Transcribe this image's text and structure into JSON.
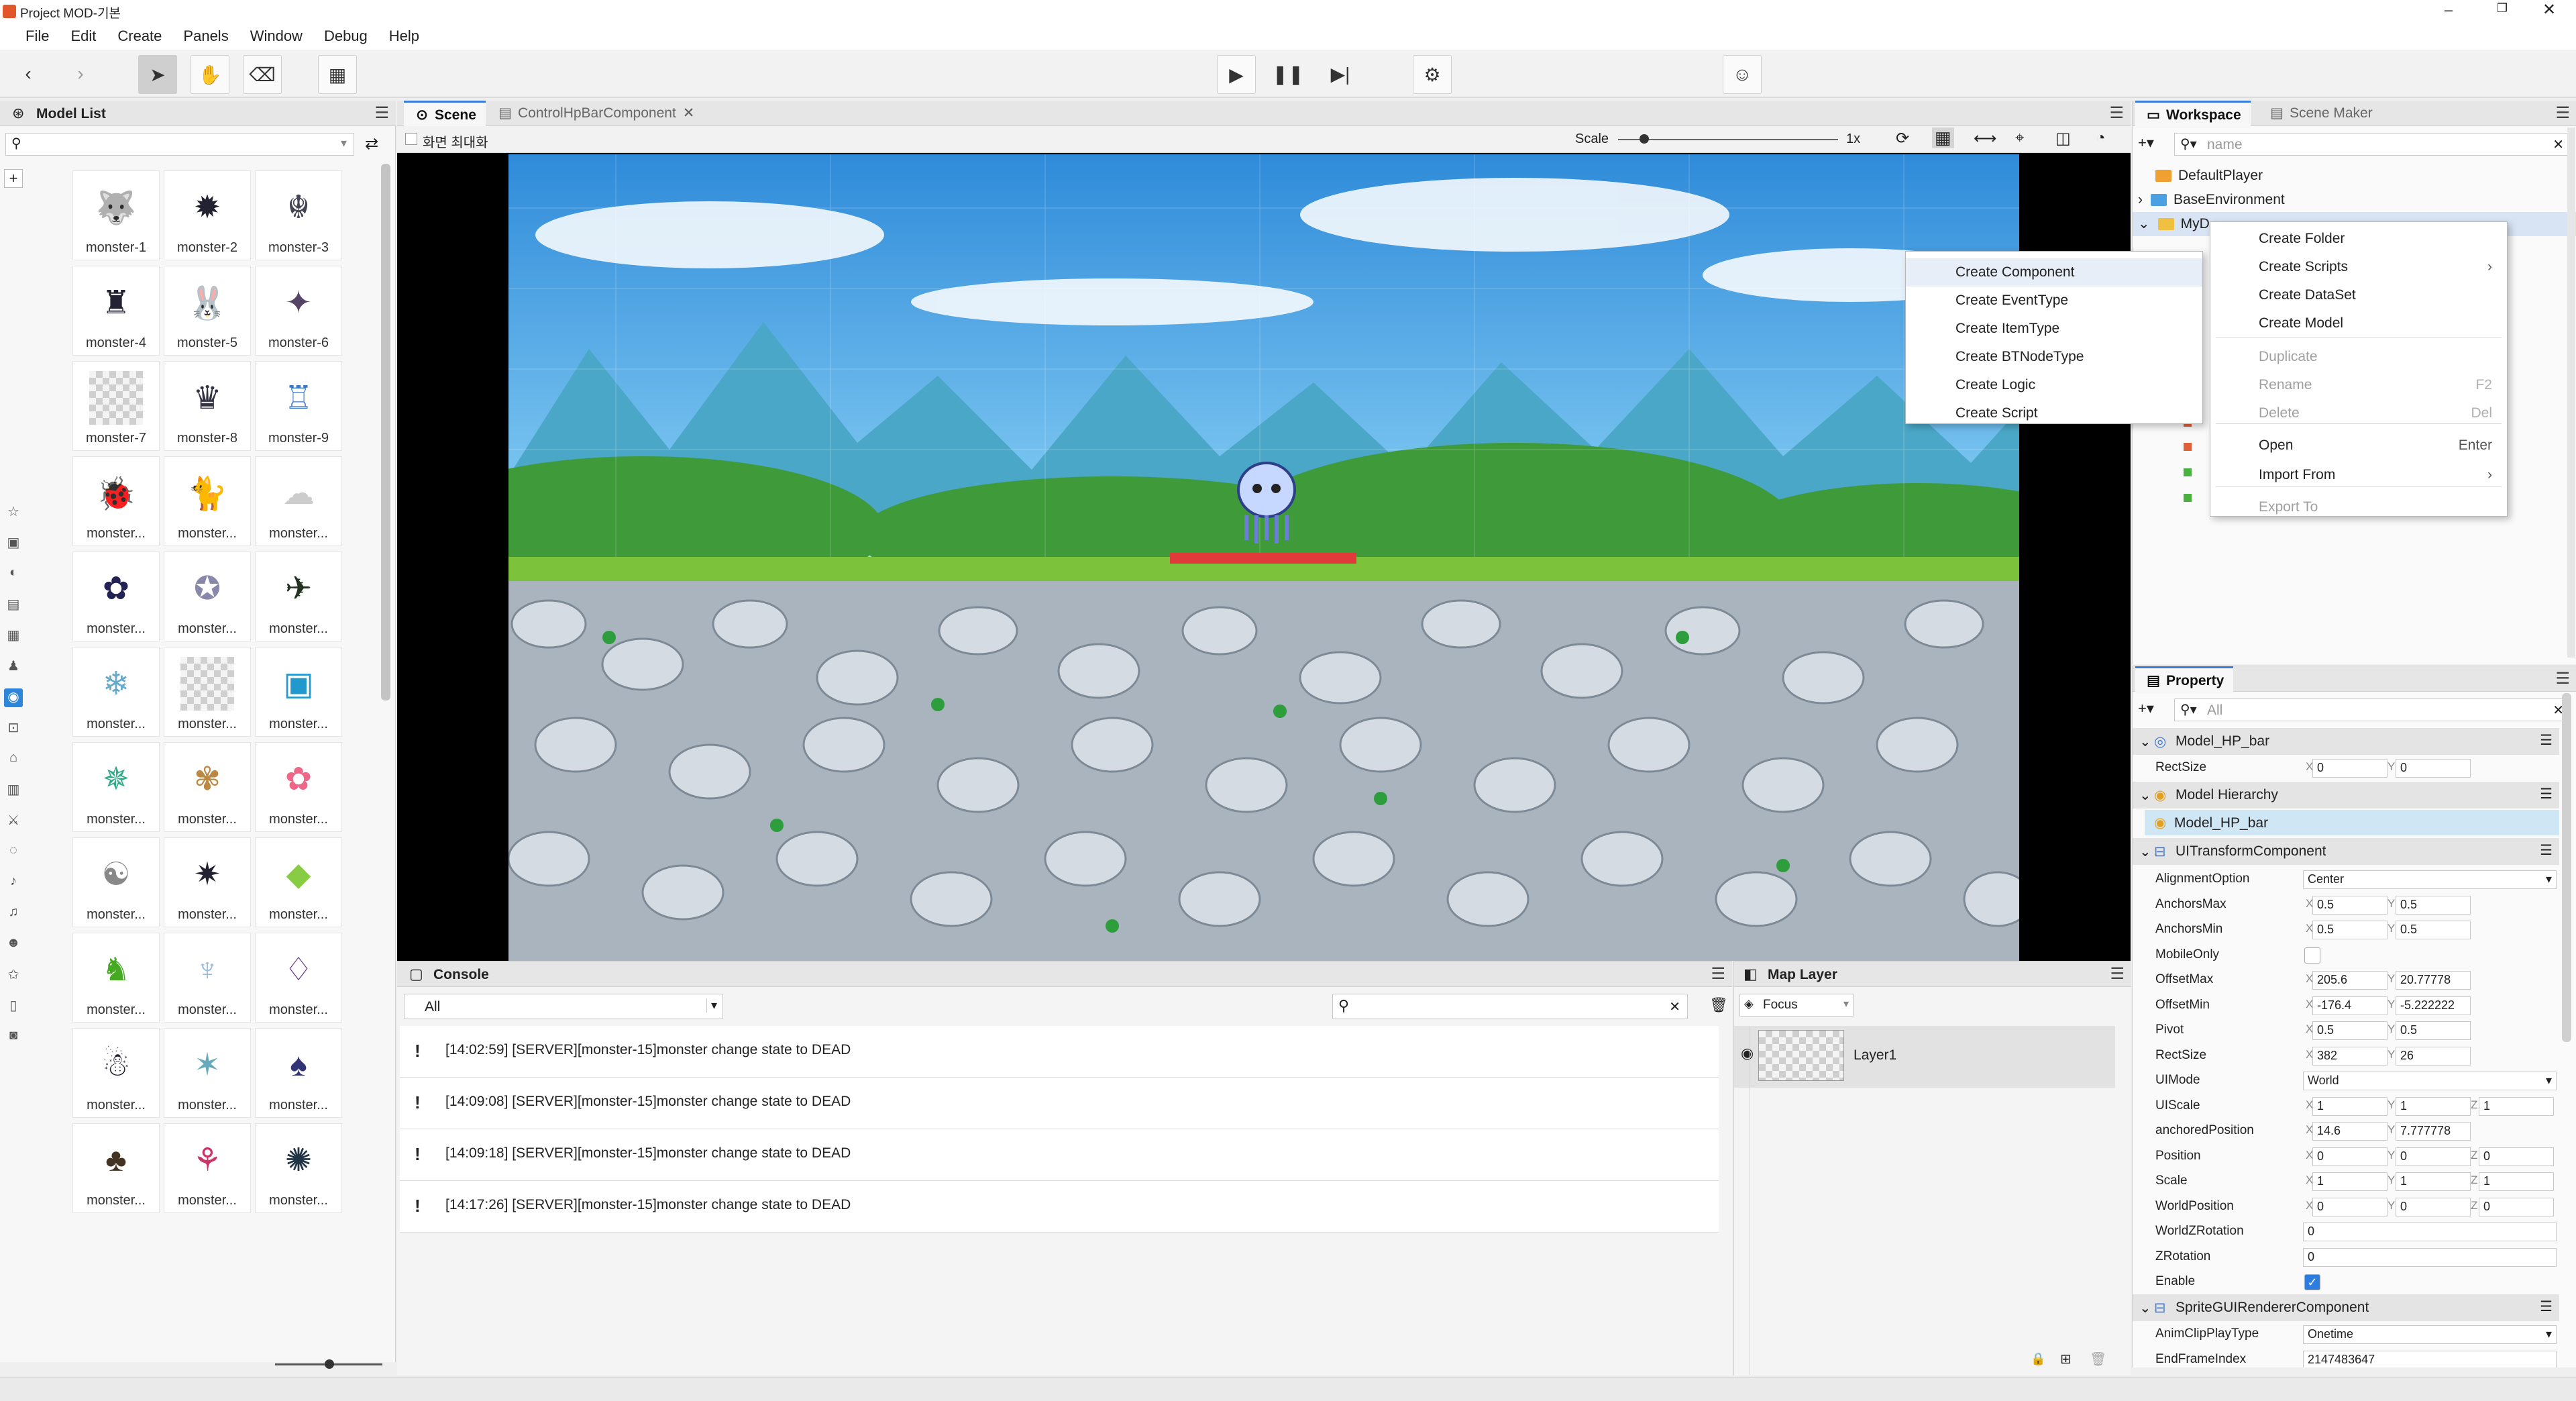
{
  "window": {
    "title": "Project MOD-기본"
  },
  "menu": [
    "File",
    "Edit",
    "Create",
    "Panels",
    "Window",
    "Debug",
    "Help"
  ],
  "model_list": {
    "title": "Model List",
    "search_placeholder": "",
    "items": [
      "monster-1",
      "monster-2",
      "monster-3",
      "monster-4",
      "monster-5",
      "monster-6",
      "monster-7",
      "monster-8",
      "monster-9",
      "monster...",
      "monster...",
      "monster...",
      "monster...",
      "monster...",
      "monster...",
      "monster...",
      "monster...",
      "monster...",
      "monster...",
      "monster...",
      "monster...",
      "monster...",
      "monster...",
      "monster...",
      "monster...",
      "monster...",
      "monster...",
      "monster...",
      "monster...",
      "monster...",
      "monster...",
      "monster...",
      "monster..."
    ]
  },
  "scene": {
    "tabs": [
      "Scene",
      "ControlHpBarComponent"
    ],
    "maximize_label": "화면 최대화",
    "scale_label": "Scale",
    "scale_value": "1x",
    "scale_slider_value": 0.12
  },
  "console": {
    "title": "Console",
    "filter": "All",
    "logs": [
      "[14:02:59] [SERVER][monster-15]monster change state to DEAD",
      "[14:09:08] [SERVER][monster-15]monster change state to DEAD",
      "[14:09:18] [SERVER][monster-15]monster change state to DEAD",
      "[14:17:26] [SERVER][monster-15]monster change state to DEAD"
    ]
  },
  "map_layer": {
    "title": "Map Layer",
    "focus_label": "Focus",
    "layers": [
      "Layer1"
    ]
  },
  "workspace": {
    "tabs": [
      "Workspace",
      "Scene Maker"
    ],
    "search_placeholder": "name",
    "tree": [
      "DefaultPlayer",
      "BaseEnvironment",
      "MyD"
    ]
  },
  "context_menu_main": [
    {
      "label": "Create Folder",
      "shortcut": "",
      "disabled": false
    },
    {
      "label": "Create Scripts",
      "shortcut": "›",
      "disabled": false
    },
    {
      "label": "Create DataSet",
      "shortcut": "",
      "disabled": false
    },
    {
      "label": "Create Model",
      "shortcut": "",
      "disabled": false
    },
    {
      "label": "Duplicate",
      "shortcut": "",
      "disabled": true
    },
    {
      "label": "Rename",
      "shortcut": "F2",
      "disabled": true
    },
    {
      "label": "Delete",
      "shortcut": "Del",
      "disabled": true
    },
    {
      "label": "Open",
      "shortcut": "Enter",
      "disabled": false
    },
    {
      "label": "Import From",
      "shortcut": "›",
      "disabled": false
    },
    {
      "label": "Export To",
      "shortcut": "",
      "disabled": true
    }
  ],
  "context_menu_sub": [
    "Create Component",
    "Create EventType",
    "Create ItemType",
    "Create BTNodeType",
    "Create Logic",
    "Create Script"
  ],
  "property": {
    "title": "Property",
    "search_placeholder": "All",
    "model_name": "Model_HP_bar",
    "rectsize_top": {
      "label": "RectSize",
      "x": "0",
      "y": "0"
    },
    "hierarchy_title": "Model Hierarchy",
    "hierarchy_item": "Model_HP_bar",
    "ui_transform_title": "UITransformComponent",
    "rows": [
      {
        "label": "AlignmentOption",
        "value": "Center"
      },
      {
        "label": "AnchorsMax",
        "x": "0.5",
        "y": "0.5"
      },
      {
        "label": "AnchorsMin",
        "x": "0.5",
        "y": "0.5"
      },
      {
        "label": "MobileOnly",
        "check": false
      },
      {
        "label": "OffsetMax",
        "x": "205.6",
        "y": "20.77778"
      },
      {
        "label": "OffsetMin",
        "x": "-176.4",
        "y": "-5.222222"
      },
      {
        "label": "Pivot",
        "x": "0.5",
        "y": "0.5"
      },
      {
        "label": "RectSize",
        "x": "382",
        "y": "26"
      },
      {
        "label": "UIMode",
        "value": "World"
      },
      {
        "label": "UIScale",
        "x": "1",
        "y": "1",
        "z": "1"
      },
      {
        "label": "anchoredPosition",
        "x": "14.6",
        "y": "7.777778"
      },
      {
        "label": "Position",
        "x": "0",
        "y": "0",
        "z": "0"
      },
      {
        "label": "Scale",
        "x": "1",
        "y": "1",
        "z": "1"
      },
      {
        "label": "WorldPosition",
        "x": "0",
        "y": "0",
        "z": "0"
      },
      {
        "label": "WorldZRotation",
        "value": "0"
      },
      {
        "label": "ZRotation",
        "value": "0"
      },
      {
        "label": "Enable",
        "check": true
      }
    ],
    "sprite_title": "SpriteGUIRendererComponent",
    "sprite_rows": [
      {
        "label": "AnimClipPlayType",
        "value": "Onetime"
      },
      {
        "label": "EndFrameIndex",
        "value": "2147483647"
      }
    ]
  },
  "colors": {
    "accent": "#3b7ddb",
    "sky": "#3f8fd8",
    "hp_bar": "#e03a3a",
    "check": "#2b7de0"
  }
}
